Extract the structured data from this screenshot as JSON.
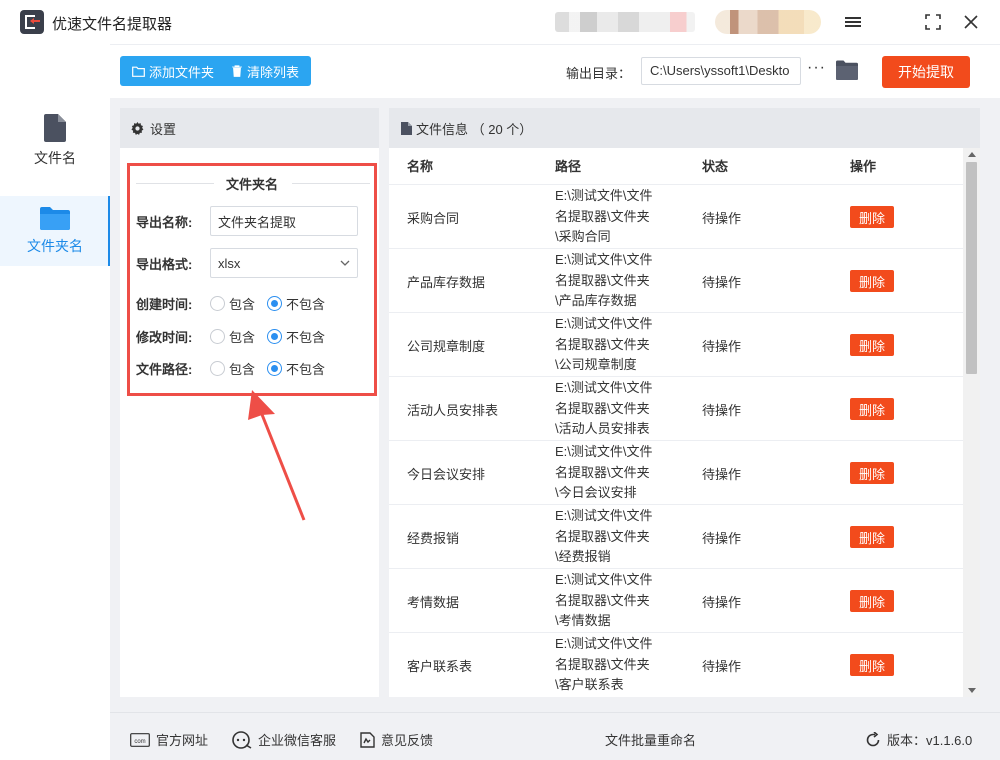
{
  "app": {
    "title": "优速文件名提取器"
  },
  "nav": {
    "items": [
      {
        "label": "文件名",
        "icon": "file-icon",
        "active": false
      },
      {
        "label": "文件夹名",
        "icon": "folder-icon",
        "active": true
      }
    ]
  },
  "toolbar": {
    "add_folder": "添加文件夹",
    "clear_list": "清除列表",
    "output_label": "输出目录：",
    "output_path": "C:\\Users\\yssoft1\\Deskto",
    "more": "···",
    "start": "开始提取"
  },
  "settings": {
    "header": "设置",
    "section_title": "文件夹名",
    "export_name_label": "导出名称:",
    "export_name_value": "文件夹名提取",
    "export_format_label": "导出格式:",
    "export_format_value": "xlsx",
    "include": "包含",
    "exclude": "不包含",
    "options": [
      {
        "label": "创建时间:",
        "selected": "exclude"
      },
      {
        "label": "修改时间:",
        "selected": "exclude"
      },
      {
        "label": "文件路径:",
        "selected": "exclude"
      }
    ]
  },
  "files": {
    "header": "文件信息 （ 20 个）",
    "columns": [
      "名称",
      "路径",
      "状态",
      "操作"
    ],
    "delete_label": "删除",
    "rows": [
      {
        "name": "采购合同",
        "path": [
          "E:\\测试文件\\文件",
          "名提取器\\文件夹",
          "\\采购合同"
        ],
        "state": "待操作"
      },
      {
        "name": "产品库存数据",
        "path": [
          "E:\\测试文件\\文件",
          "名提取器\\文件夹",
          "\\产品库存数据"
        ],
        "state": "待操作"
      },
      {
        "name": "公司规章制度",
        "path": [
          "E:\\测试文件\\文件",
          "名提取器\\文件夹",
          "\\公司规章制度"
        ],
        "state": "待操作"
      },
      {
        "name": "活动人员安排表",
        "path": [
          "E:\\测试文件\\文件",
          "名提取器\\文件夹",
          "\\活动人员安排表"
        ],
        "state": "待操作"
      },
      {
        "name": "今日会议安排",
        "path": [
          "E:\\测试文件\\文件",
          "名提取器\\文件夹",
          "\\今日会议安排"
        ],
        "state": "待操作"
      },
      {
        "name": "经费报销",
        "path": [
          "E:\\测试文件\\文件",
          "名提取器\\文件夹",
          "\\经费报销"
        ],
        "state": "待操作"
      },
      {
        "name": "考情数据",
        "path": [
          "E:\\测试文件\\文件",
          "名提取器\\文件夹",
          "\\考情数据"
        ],
        "state": "待操作"
      },
      {
        "name": "客户联系表",
        "path": [
          "E:\\测试文件\\文件",
          "名提取器\\文件夹",
          "\\客户联系表"
        ],
        "state": "待操作"
      }
    ]
  },
  "footer": {
    "website": "官方网址",
    "wechat": "企业微信客服",
    "feedback": "意见反馈",
    "batch_rename": "文件批量重命名",
    "version": "版本：v1.1.6.0"
  },
  "colors": {
    "accent": "#2ba5f1",
    "danger": "#f24b1c",
    "annotation": "#ee4e47"
  }
}
